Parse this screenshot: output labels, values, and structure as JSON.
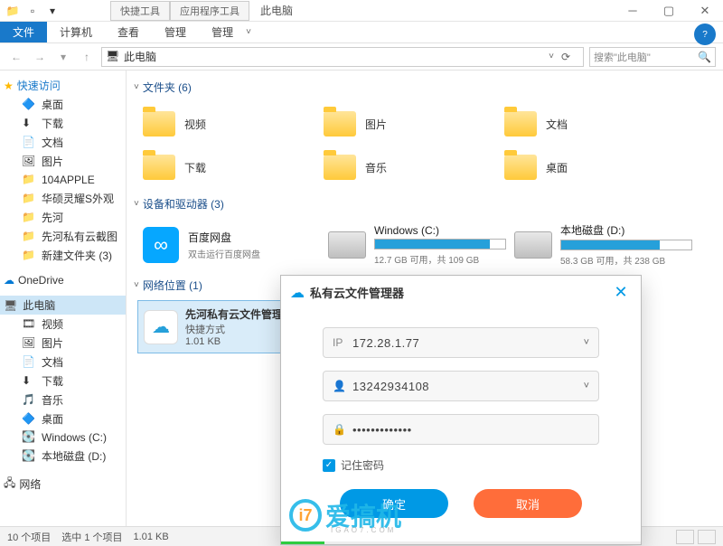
{
  "titlebar": {
    "ctx_tabs": [
      "快捷工具",
      "应用程序工具"
    ],
    "window_title": "此电脑"
  },
  "ribbon": {
    "file": "文件",
    "tabs": [
      "计算机",
      "查看",
      "管理",
      "管理"
    ]
  },
  "address": {
    "location": "此电脑",
    "search_placeholder": "搜索\"此电脑\""
  },
  "sidebar": {
    "quick_access": "快速访问",
    "qa_items": [
      "桌面",
      "下载",
      "文档",
      "图片",
      "104APPLE",
      "华硕灵耀S外观",
      "先河",
      "先河私有云截图",
      "新建文件夹 (3)"
    ],
    "onedrive": "OneDrive",
    "thispc": "此电脑",
    "pc_items": [
      "视频",
      "图片",
      "文档",
      "下载",
      "音乐",
      "桌面",
      "Windows (C:)",
      "本地磁盘 (D:)"
    ],
    "network": "网络"
  },
  "sections": {
    "folders": {
      "label": "文件夹 (6)",
      "items": [
        "视频",
        "图片",
        "文档",
        "下载",
        "音乐",
        "桌面"
      ]
    },
    "devices": {
      "label": "设备和驱动器 (3)",
      "baidu": {
        "name": "百度网盘",
        "sub": "双击运行百度网盘"
      },
      "c": {
        "name": "Windows (C:)",
        "sub": "12.7 GB 可用，共 109 GB",
        "fill": 88
      },
      "d": {
        "name": "本地磁盘 (D:)",
        "sub": "58.3 GB 可用，共 238 GB",
        "fill": 76
      }
    },
    "network": {
      "label": "网络位置 (1)",
      "item": {
        "name": "先河私有云文件管理器",
        "type": "快捷方式",
        "size": "1.01 KB"
      }
    }
  },
  "dialog": {
    "title": "私有云文件管理器",
    "ip_label": "IP",
    "ip_value": "172.28.1.77",
    "user_value": "13242934108",
    "pwd_value": "•••••••••••••",
    "remember": "记住密码",
    "ok": "确定",
    "cancel": "取消"
  },
  "watermark": {
    "text": "爱搞机",
    "url": "IGAO7.COM"
  },
  "statusbar": {
    "items": "10 个项目",
    "selected": "选中 1 个项目",
    "size": "1.01 KB"
  }
}
